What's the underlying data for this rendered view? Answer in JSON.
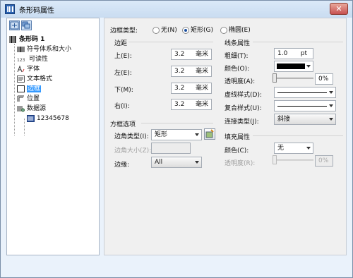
{
  "window": {
    "title": "条形码属性",
    "close_label": "✕"
  },
  "tree": {
    "items": [
      {
        "label": "条形码 1",
        "icon": "barcode-icon"
      },
      {
        "label": "符号体系和大小",
        "icon": "barcode-small-icon"
      },
      {
        "label": "可读性",
        "icon": "readability-icon",
        "prefix": "123"
      },
      {
        "label": "字体",
        "icon": "font-icon"
      },
      {
        "label": "文本格式",
        "icon": "text-format-icon"
      },
      {
        "label": "边框",
        "icon": "border-icon"
      },
      {
        "label": "位置",
        "icon": "position-icon"
      },
      {
        "label": "数据源",
        "icon": "datasource-icon"
      },
      {
        "label": "12345678",
        "icon": "data-field-icon"
      }
    ],
    "selected_index": 5
  },
  "border_type": {
    "label": "边框类型:",
    "options": [
      "无(N)",
      "矩形(G)",
      "椭圆(E)"
    ],
    "selected": "矩形(G)"
  },
  "margins": {
    "title": "边距",
    "rows": [
      {
        "label": "上(E):",
        "value": "3.2",
        "unit": "毫米"
      },
      {
        "label": "左(E):",
        "value": "3.2",
        "unit": "毫米"
      },
      {
        "label": "下(M):",
        "value": "3.2",
        "unit": "毫米"
      },
      {
        "label": "右(I):",
        "value": "3.2",
        "unit": "毫米"
      }
    ]
  },
  "frame": {
    "title": "方框选项",
    "corner_type_label": "边角类型(I):",
    "corner_type_value": "矩形",
    "corner_size_label": "边角大小(Z):",
    "corner_size_value": "",
    "edges_label": "边缘:",
    "edges_value": "All"
  },
  "line": {
    "title": "线条属性",
    "thickness_label": "粗细(T):",
    "thickness_value": "1.0",
    "thickness_unit": "pt",
    "color_label": "颜色(O):",
    "color_value": "#000000",
    "transparency_label": "透明度(A):",
    "transparency_value": "0%",
    "transparency_level": 0,
    "dash_label": "虚线样式(D):",
    "compound_label": "复合样式(U):",
    "join_label": "连接类型(J):",
    "join_value": "斜接"
  },
  "fill": {
    "title": "填充属性",
    "color_label": "颜色(C):",
    "color_value": "无",
    "transparency_label": "透明度(R):",
    "transparency_value": "0%",
    "transparency_level": 0
  }
}
